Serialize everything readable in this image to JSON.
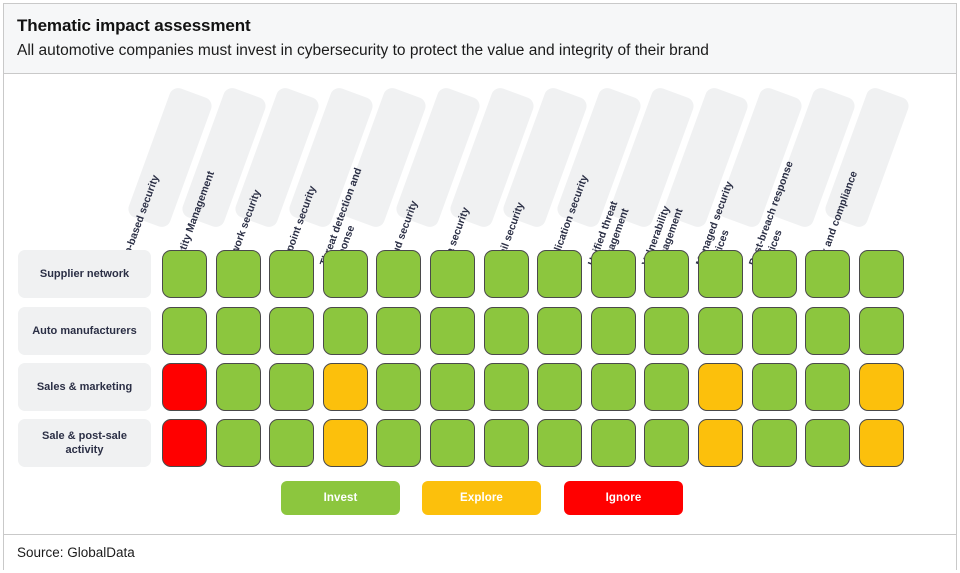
{
  "header": {
    "title": "Thematic impact assessment",
    "subtitle": "All automotive companies must invest in cybersecurity to protect the value and integrity of their brand"
  },
  "footer": {
    "source": "Source: GlobalData"
  },
  "legend": [
    {
      "label": "Invest",
      "color": "#8CC63E"
    },
    {
      "label": "Explore",
      "color": "#FCC00C"
    },
    {
      "label": "Ignore",
      "color": "#FF0000"
    }
  ],
  "palette": {
    "invest": "#8CC63E",
    "explore": "#FCC00C",
    "ignore": "#FF0000",
    "tile_bg": "#F0F1F2",
    "header_bg": "#F6F7F8",
    "border": "#C9C9C9",
    "text": "#2B2F45"
  },
  "chart_data": {
    "type": "heatmap",
    "title": "Thematic impact assessment",
    "subtitle": "All automotive companies must invest in cybersecurity to protect the value and integrity of their brand",
    "xlabel": "",
    "ylabel": "",
    "legend_position": "bottom-center",
    "grid": false,
    "value_labels": {
      "invest": "Invest",
      "explore": "Explore",
      "ignore": "Ignore"
    },
    "categories": [
      "Chip-based security",
      "Identity Management",
      "Network security",
      "Endpoint security",
      "Threat detection and\nresponse",
      "Cloud security",
      "Data security",
      "Email security",
      "Application security",
      "Unified threat\nmanagement",
      "Vulnerability\nmanagement",
      "Managed security\nservices",
      "Post-breach response\nservices",
      "Risk and compliance"
    ],
    "rows": [
      "Supplier network",
      "Auto manufacturers",
      "Sales & marketing",
      "Sale & post-sale\nactivity"
    ],
    "series": [
      {
        "name": "Supplier network",
        "values": [
          "invest",
          "invest",
          "invest",
          "invest",
          "invest",
          "invest",
          "invest",
          "invest",
          "invest",
          "invest",
          "invest",
          "invest",
          "invest",
          "invest"
        ]
      },
      {
        "name": "Auto manufacturers",
        "values": [
          "invest",
          "invest",
          "invest",
          "invest",
          "invest",
          "invest",
          "invest",
          "invest",
          "invest",
          "invest",
          "invest",
          "invest",
          "invest",
          "invest"
        ]
      },
      {
        "name": "Sales & marketing",
        "values": [
          "ignore",
          "invest",
          "invest",
          "explore",
          "invest",
          "invest",
          "invest",
          "invest",
          "invest",
          "invest",
          "explore",
          "invest",
          "invest",
          "explore"
        ]
      },
      {
        "name": "Sale & post-sale activity",
        "values": [
          "ignore",
          "invest",
          "invest",
          "explore",
          "invest",
          "invest",
          "invest",
          "invest",
          "invest",
          "invest",
          "explore",
          "invest",
          "invest",
          "explore"
        ]
      }
    ]
  }
}
